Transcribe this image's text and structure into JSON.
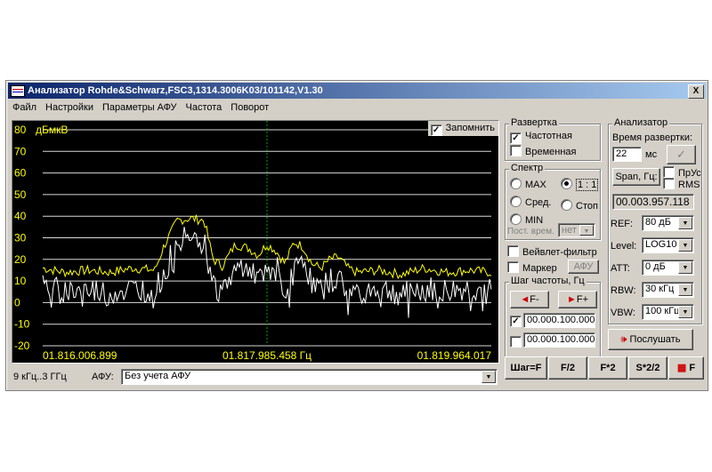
{
  "window": {
    "title": "Анализатор Rohde&Schwarz,FSC3,1314.3006K03/101142,V1.30",
    "close_label": "X"
  },
  "menu": [
    "Файл",
    "Настройки",
    "Параметры АФУ",
    "Частота",
    "Поворот"
  ],
  "plot": {
    "unit_label": "дБмкВ",
    "y_ticks": [
      "80",
      "70",
      "60",
      "50",
      "40",
      "30",
      "20",
      "10",
      "0",
      "-10",
      "-20"
    ],
    "x_labels": {
      "left": "01.816.006.899",
      "center": "01.817.985.458 Гц",
      "right": "01.819.964.017"
    },
    "remember": {
      "label": "Запомнить",
      "checked": true
    },
    "colors": {
      "background": "#000000",
      "grid": "#ffffff",
      "trace_max": "#ffff00",
      "trace_live": "#ffffff",
      "center_marker": "#00a000",
      "labels": "#ffff00"
    }
  },
  "chart_data": {
    "type": "line",
    "ylabel": "дБмкВ",
    "ylim": [
      -20,
      80
    ],
    "x_tick_labels": [
      "01.816.006.899",
      "01.817.985.458 Гц",
      "01.819.964.017"
    ],
    "series": [
      {
        "color": "#ffff00",
        "x": [
          0.0,
          0.05,
          0.1,
          0.15,
          0.2,
          0.25,
          0.27,
          0.3,
          0.33,
          0.36,
          0.38,
          0.4,
          0.43,
          0.46,
          0.48,
          0.5,
          0.52,
          0.54,
          0.56,
          0.58,
          0.6,
          0.62,
          0.64,
          0.66,
          0.68,
          0.7,
          0.75,
          0.8,
          0.85,
          0.9,
          0.95,
          1.0
        ],
        "values": [
          16,
          14,
          15,
          14,
          16,
          15,
          26,
          38,
          39,
          38,
          20,
          17,
          27,
          25,
          22,
          27,
          24,
          18,
          28,
          26,
          18,
          16,
          20,
          21,
          16,
          14,
          15,
          13,
          16,
          14,
          15,
          14
        ]
      },
      {
        "color": "#ffffff",
        "x": [
          0.0,
          0.05,
          0.1,
          0.15,
          0.2,
          0.25,
          0.27,
          0.3,
          0.33,
          0.36,
          0.38,
          0.4,
          0.43,
          0.46,
          0.48,
          0.5,
          0.52,
          0.54,
          0.56,
          0.58,
          0.6,
          0.62,
          0.64,
          0.66,
          0.68,
          0.7,
          0.75,
          0.8,
          0.85,
          0.9,
          0.95,
          1.0
        ],
        "values": [
          7,
          5,
          6,
          4,
          6,
          6,
          12,
          30,
          35,
          28,
          8,
          5,
          15,
          18,
          10,
          12,
          17,
          5,
          14,
          22,
          8,
          6,
          10,
          11,
          4,
          5,
          6,
          4,
          6,
          5,
          6,
          5
        ]
      }
    ]
  },
  "sweep": {
    "title": "Развертка",
    "frequency": {
      "label": "Частотная",
      "checked": true
    },
    "time": {
      "label": "Временная",
      "checked": false
    }
  },
  "spectrum": {
    "title": "Спектр",
    "max": "MAX",
    "ratio": "1 : 1",
    "avg": "Сред.",
    "stop": "Стоп",
    "min": "MIN",
    "const_label": "Пост. врем.",
    "const_value": "нет",
    "selected": "ratio"
  },
  "wavelet": {
    "label": "Вейвлет-фильтр",
    "checked": false
  },
  "marker": {
    "label": "Маркер",
    "checked": false,
    "afu_button": "АФУ"
  },
  "freq_step": {
    "title": "Шаг частоты, Гц",
    "minus": "F-",
    "plus": "F+",
    "value1": "00.000.100.000",
    "value1_checked": true,
    "value2": "00.000.100.000",
    "value2_checked": false
  },
  "bottom_buttons": [
    "Шаг=F",
    "F/2",
    "F*2",
    "S*2/2",
    "F"
  ],
  "analyzer": {
    "title": "Анализатор",
    "sweep_time_label": "Время развертки:",
    "sweep_time_value": "22",
    "sweep_time_unit": "мс",
    "span_button": "Span, Гц:",
    "pruc": {
      "label": "ПрУс",
      "checked": false
    },
    "rms": {
      "label": "RMS",
      "checked": false
    },
    "span_value": "00.003.957.118",
    "ref": {
      "label": "REF:",
      "value": "80 дБ"
    },
    "level": {
      "label": "Level:",
      "value": "LOG10"
    },
    "att": {
      "label": "ATT:",
      "value": "0 дБ"
    },
    "rbw": {
      "label": "RBW:",
      "value": "30 кГц"
    },
    "vbw": {
      "label": "VBW:",
      "value": "100 кГц"
    },
    "listen_button": "Послушать"
  },
  "status": {
    "range": "9 кГц..3 ГГц",
    "afu_label": "АФУ:",
    "afu_value": "Без учета АФУ"
  }
}
